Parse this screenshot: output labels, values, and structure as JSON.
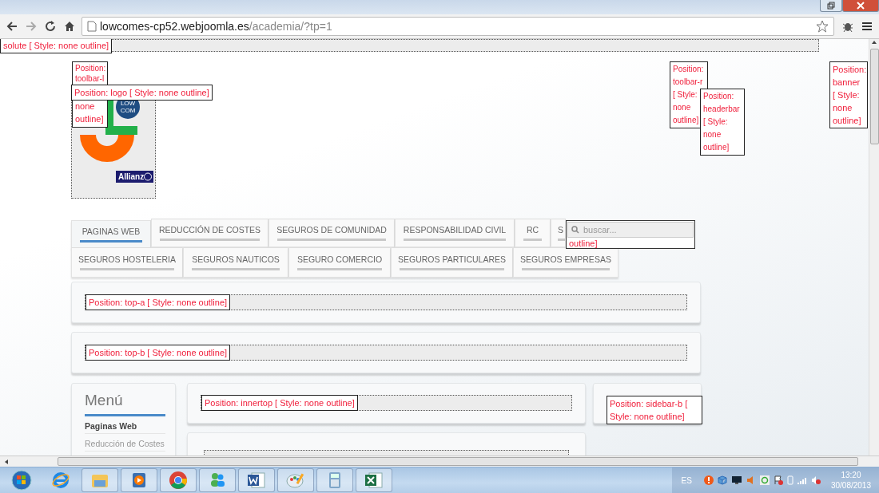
{
  "browser": {
    "url_host": "lowcomes-cp52.webjoomla.es",
    "url_path": "/academia/?tp=1"
  },
  "page": {
    "top_bar_label": "solute [ Style: none outline]",
    "header_labels": {
      "toolbar_l_top": "Position: toolbar-l",
      "toolbar_l_bottom": "none outline]",
      "logo": "Position: logo [ Style: none outline]",
      "toolbar_r": "Position: toolbar-r [ Style: none outline]",
      "headerbar": "Position: headerbar [ Style: none outline]",
      "banner": "Position: banner [ Style: none outline]"
    },
    "logo": {
      "badge_lines": [
        "LOW",
        "COM"
      ],
      "brand": "Allianz"
    },
    "nav_rows": [
      [
        {
          "label": "PAGINAS WEB",
          "selected": true
        },
        {
          "label": "REDUCCIÓN DE COSTES",
          "selected": false
        },
        {
          "label": "SEGUROS DE COMUNIDAD",
          "selected": false
        },
        {
          "label": "RESPONSABILIDAD CIVIL",
          "selected": false
        },
        {
          "label": "RC",
          "selected": false
        },
        {
          "label": "S",
          "selected": false
        }
      ],
      [
        {
          "label": "SEGUROS HOSTELERIA",
          "selected": false
        },
        {
          "label": "SEGUROS NAUTICOS",
          "selected": false
        },
        {
          "label": "SEGURO COMERCIO",
          "selected": false
        },
        {
          "label": "SEGUROS PARTICULARES",
          "selected": false
        },
        {
          "label": "SEGUROS EMPRESAS",
          "selected": false
        }
      ]
    ],
    "search": {
      "placeholder": "buscar...",
      "label": "outline]"
    },
    "top_modules": [
      "Position: top-a [ Style: none outline]",
      "Position: top-b [ Style: none outline]"
    ],
    "menu": {
      "title": "Menú",
      "items": [
        {
          "label": "Paginas Web",
          "selected": true
        },
        {
          "label": "Reducción de Costes",
          "selected": false
        }
      ]
    },
    "innertop_label": "Position: innertop [ Style: none outline]",
    "sidebar_label": "Position: sidebar-b [ Style: none outline]"
  },
  "taskbar": {
    "language": "ES",
    "time": "13:20",
    "date": "30/08/2013"
  }
}
